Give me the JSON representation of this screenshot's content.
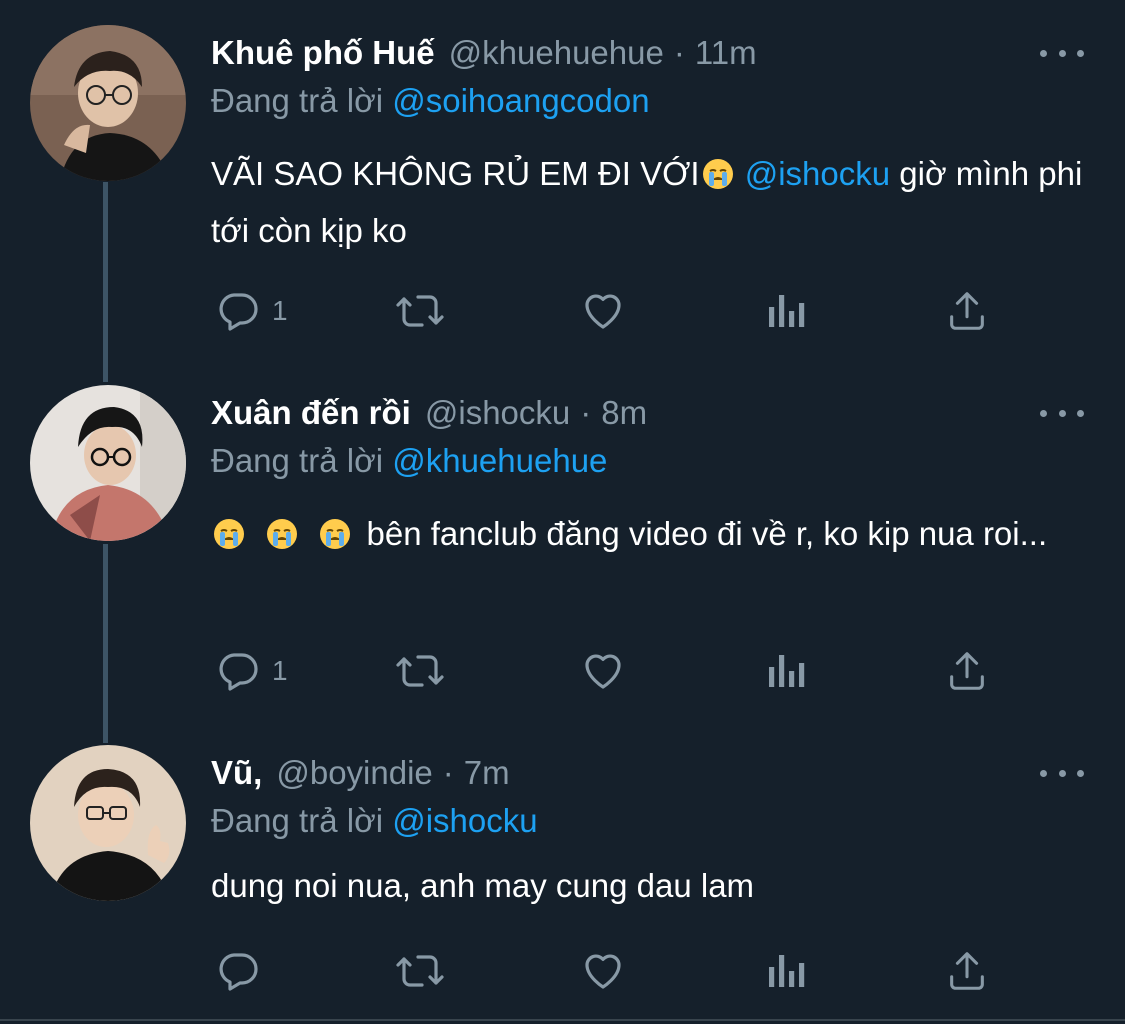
{
  "tweets": [
    {
      "name": "Khuê phố Huế",
      "handle": "@khuehuehue",
      "separator": "·",
      "time": "11m",
      "reply_prefix": "Đang trả lời",
      "reply_to": "@soihoangcodon",
      "text_part1": "VÃI SAO KHÔNG RỦ EM ĐI VỚI",
      "mention": "@ishocku",
      "text_part2": " giờ mình phi tới còn kịp ko",
      "reply_count": "1"
    },
    {
      "name": "Xuân đến rồi",
      "handle": "@ishocku",
      "separator": "·",
      "time": "8m",
      "reply_prefix": "Đang trả lời",
      "reply_to": "@khuehuehue",
      "text": " bên fanclub đăng video đi về r, ko kip nua roi...",
      "reply_count": "1"
    },
    {
      "name": "Vũ,",
      "handle": "@boyindie",
      "separator": "·",
      "time": "7m",
      "reply_prefix": "Đang trả lời",
      "reply_to": "@ishocku",
      "text": "dung noi nua, anh may cung dau lam",
      "reply_count": ""
    }
  ],
  "icons": {
    "reply": "reply-icon",
    "retweet": "retweet-icon",
    "like": "heart-icon",
    "analytics": "analytics-icon",
    "share": "share-icon",
    "more": "more-icon",
    "emoji": "loudly-crying-face-emoji"
  },
  "colors": {
    "background": "#15202b",
    "text": "#ffffff",
    "secondary": "#8899a6",
    "accent": "#1da1f2",
    "thread_line": "#3d5466"
  }
}
